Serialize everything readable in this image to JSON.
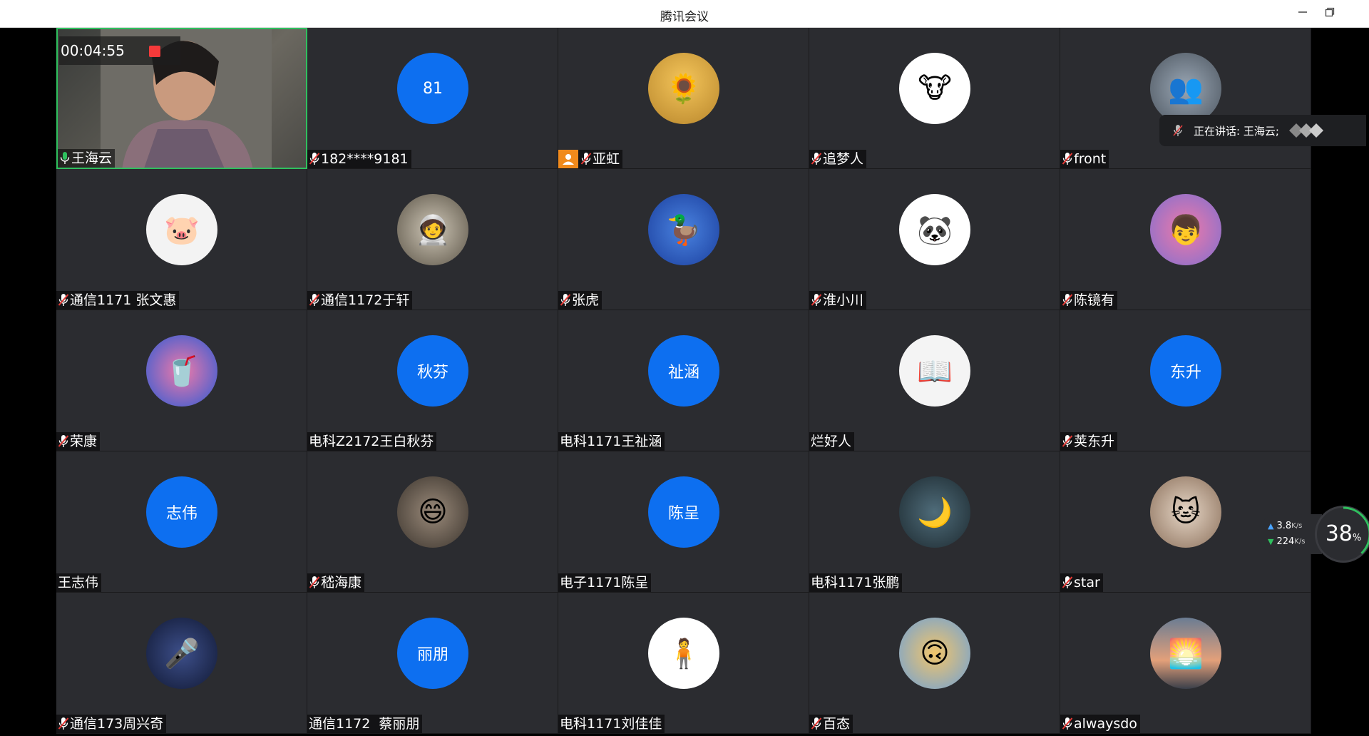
{
  "window": {
    "title": "腾讯会议",
    "minimize_icon": "minimize-icon",
    "restore_icon": "restore-icon"
  },
  "recording": {
    "elapsed": "00:04:55",
    "status_color": "#f53a3a"
  },
  "speaking_indicator": {
    "label": "正在讲话: 王海云;"
  },
  "network": {
    "upload": "3.8",
    "upload_unit": "K/s",
    "download": "224",
    "download_unit": "K/s",
    "cpu_percent": "38",
    "cpu_unit": "%"
  },
  "colors": {
    "tile_bg": "#2b2c30",
    "avatar_blue": "#0d6ff0",
    "active_speaker_border": "#2fc05e",
    "host_badge": "#f08a1c"
  },
  "participants": [
    {
      "name": "王海云",
      "avatar_type": "video",
      "mic": "on"
    },
    {
      "name": "182****9181",
      "avatar_type": "text",
      "avatar_text": "81",
      "mic": "off"
    },
    {
      "name": "亚虹",
      "avatar_type": "image",
      "avatar_icon": "sunflower-girl-icon",
      "mic": "off",
      "host": true
    },
    {
      "name": "追梦人",
      "avatar_type": "image",
      "avatar_icon": "cartoon-ox-icon",
      "mic": "off"
    },
    {
      "name": "front",
      "avatar_type": "image",
      "avatar_icon": "crowd-photo-icon",
      "mic": "off"
    },
    {
      "name": "通信1171 张文惠",
      "avatar_type": "image",
      "avatar_icon": "pig-icon",
      "mic": "off"
    },
    {
      "name": "通信1172于轩",
      "avatar_type": "image",
      "avatar_icon": "astronaut-icon",
      "mic": "off"
    },
    {
      "name": "张虎",
      "avatar_type": "image",
      "avatar_icon": "duck-icon",
      "mic": "off"
    },
    {
      "name": "淮小川",
      "avatar_type": "image",
      "avatar_icon": "panda-icon",
      "mic": "off"
    },
    {
      "name": "陈镜有",
      "avatar_type": "image",
      "avatar_icon": "cartoon-boy-icon",
      "mic": "off"
    },
    {
      "name": "荣康",
      "avatar_type": "image",
      "avatar_icon": "cartoon-pepsi-icon",
      "mic": "off"
    },
    {
      "name": "电科Z2172王白秋芬",
      "avatar_type": "text",
      "avatar_text": "秋芬",
      "mic": "none"
    },
    {
      "name": "电科1171王祉涵",
      "avatar_type": "text",
      "avatar_text": "祉涵",
      "mic": "none"
    },
    {
      "name": "烂好人",
      "avatar_type": "image",
      "avatar_icon": "child-reading-icon",
      "mic": "none"
    },
    {
      "name": "荚东升",
      "avatar_type": "text",
      "avatar_text": "东升",
      "mic": "off"
    },
    {
      "name": "王志伟",
      "avatar_type": "text",
      "avatar_text": "志伟",
      "mic": "none"
    },
    {
      "name": "嵇海康",
      "avatar_type": "image",
      "avatar_icon": "laughing-child-icon",
      "mic": "off"
    },
    {
      "name": "电子1171陈呈",
      "avatar_type": "text",
      "avatar_text": "陈呈",
      "mic": "none"
    },
    {
      "name": "电科1171张鹏",
      "avatar_type": "image",
      "avatar_icon": "night-street-icon",
      "mic": "none"
    },
    {
      "name": "star",
      "avatar_type": "image",
      "avatar_icon": "cat-photo-icon",
      "mic": "off"
    },
    {
      "name": "通信173周兴奇",
      "avatar_type": "image",
      "avatar_icon": "singer-portrait-icon",
      "mic": "off"
    },
    {
      "name": "通信1172  蔡丽朋",
      "avatar_type": "text",
      "avatar_text": "丽朋",
      "mic": "none"
    },
    {
      "name": "电科1171刘佳佳",
      "avatar_type": "image",
      "avatar_icon": "sketch-figure-icon",
      "mic": "none"
    },
    {
      "name": "百态",
      "avatar_type": "image",
      "avatar_icon": "upside-down-cartoon-icon",
      "mic": "off"
    },
    {
      "name": "alwaysdo",
      "avatar_type": "image",
      "avatar_icon": "sunset-silhouette-icon",
      "mic": "off"
    }
  ]
}
